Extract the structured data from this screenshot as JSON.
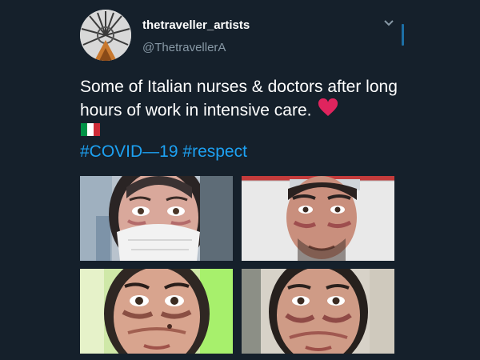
{
  "tweet": {
    "display_name": "thetraveller_artists",
    "handle": "@ThetravellerA",
    "text": "Some of Italian nurses & doctors after long hours of work in intensive care.",
    "hashtags": [
      "#COVID—19",
      "#respect"
    ],
    "heart_emoji": "red-heart-icon",
    "flag_emoji": "italy-flag-icon"
  },
  "colors": {
    "background": "#15202b",
    "text": "#ffffff",
    "secondary_text": "#8899a6",
    "link": "#1da1f2",
    "heart": "#e0245e"
  },
  "icons": {
    "menu": "chevron-down-icon"
  },
  "photos": [
    {
      "name": "nurse-with-mask-photo"
    },
    {
      "name": "male-doctor-photo"
    },
    {
      "name": "nurse-bruised-face-photo"
    },
    {
      "name": "nurse-tired-face-photo"
    }
  ]
}
